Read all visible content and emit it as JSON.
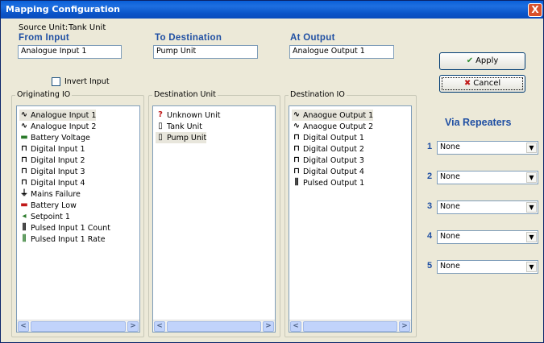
{
  "window": {
    "title": "Mapping Configuration",
    "close_label": "X"
  },
  "source": {
    "label": "Source Unit:",
    "value": "Tank Unit"
  },
  "from": {
    "label": "From Input",
    "value": "Analogue Input 1"
  },
  "to": {
    "label": "To Destination",
    "value": "Pump Unit"
  },
  "at": {
    "label": "At Output",
    "value": "Analogue Output 1"
  },
  "invert": {
    "label": "Invert Input",
    "checked": false
  },
  "buttons": {
    "apply": "Apply",
    "cancel": "Cancel"
  },
  "originating": {
    "title": "Originating IO",
    "items": [
      {
        "icon": "analogue-icon",
        "glyph": "∿",
        "label": "Analogue Input 1",
        "selected": true
      },
      {
        "icon": "analogue-icon",
        "glyph": "∿",
        "label": "Analogue Input 2",
        "selected": false
      },
      {
        "icon": "battery-voltage-icon",
        "glyph": "▬",
        "label": "Battery Voltage",
        "selected": false,
        "color": "#2a7a2a"
      },
      {
        "icon": "digital-icon",
        "glyph": "⊓",
        "label": "Digital Input 1",
        "selected": false
      },
      {
        "icon": "digital-icon",
        "glyph": "⊓",
        "label": "Digital Input 2",
        "selected": false
      },
      {
        "icon": "digital-icon",
        "glyph": "⊓",
        "label": "Digital Input 3",
        "selected": false
      },
      {
        "icon": "digital-icon",
        "glyph": "⊓",
        "label": "Digital Input 4",
        "selected": false
      },
      {
        "icon": "mains-failure-icon",
        "glyph": "⏚",
        "label": "Mains Failure",
        "selected": false
      },
      {
        "icon": "battery-low-icon",
        "glyph": "▬",
        "label": "Battery Low",
        "selected": false,
        "color": "#c01818"
      },
      {
        "icon": "setpoint-icon",
        "glyph": "◂",
        "label": "Setpoint 1",
        "selected": false,
        "color": "#2a7a2a"
      },
      {
        "icon": "pulsed-count-icon",
        "glyph": "⫼",
        "label": "Pulsed Input 1 Count",
        "selected": false
      },
      {
        "icon": "pulsed-rate-icon",
        "glyph": "⫼",
        "label": "Pulsed Input 1 Rate",
        "selected": false,
        "color": "#2a7a2a"
      }
    ]
  },
  "destination_unit": {
    "title": "Destination Unit",
    "items": [
      {
        "icon": "unknown-unit-icon",
        "glyph": "?",
        "label": "Unknown Unit",
        "selected": false,
        "color": "#c01818"
      },
      {
        "icon": "tank-unit-icon",
        "glyph": "▯",
        "label": "Tank Unit",
        "selected": false
      },
      {
        "icon": "pump-unit-icon",
        "glyph": "▯",
        "label": "Pump Unit",
        "selected": true
      }
    ]
  },
  "destination_io": {
    "title": "Destination IO",
    "items": [
      {
        "icon": "analogue-icon",
        "glyph": "∿",
        "label": "Anaogue Output 1",
        "selected": true
      },
      {
        "icon": "analogue-icon",
        "glyph": "∿",
        "label": "Anaogue Output 2",
        "selected": false
      },
      {
        "icon": "digital-icon",
        "glyph": "⊓",
        "label": "Digital Output 1",
        "selected": false
      },
      {
        "icon": "digital-icon",
        "glyph": "⊓",
        "label": "Digital Output 2",
        "selected": false
      },
      {
        "icon": "digital-icon",
        "glyph": "⊓",
        "label": "Digital Output 3",
        "selected": false
      },
      {
        "icon": "digital-icon",
        "glyph": "⊓",
        "label": "Digital Output 4",
        "selected": false
      },
      {
        "icon": "pulsed-icon",
        "glyph": "⫼",
        "label": "Pulsed Output 1",
        "selected": false
      }
    ]
  },
  "via": {
    "title": "Via Repeaters",
    "rows": [
      {
        "num": "1",
        "value": "None"
      },
      {
        "num": "2",
        "value": "None"
      },
      {
        "num": "3",
        "value": "None"
      },
      {
        "num": "4",
        "value": "None"
      },
      {
        "num": "5",
        "value": "None"
      }
    ]
  },
  "scroll": {
    "left": "<",
    "right": ">"
  }
}
